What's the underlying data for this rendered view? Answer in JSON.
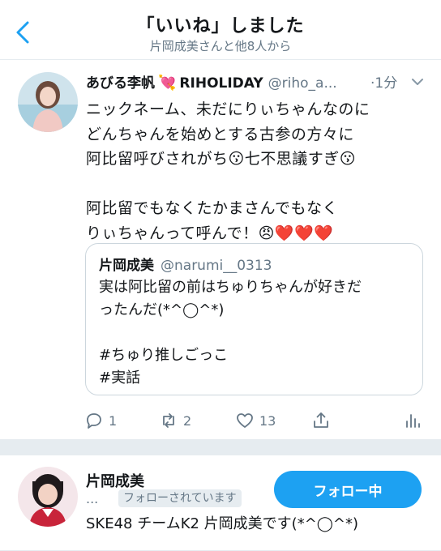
{
  "header": {
    "title": "「いいね」しました",
    "subtitle": "片岡成美さんと他8人から"
  },
  "tweet": {
    "name": "あびる李帆",
    "name_suffix": "RIHOLIDAY",
    "handle": "@riho_a...",
    "time": "·1分",
    "lines": [
      "ニックネーム、未だにりぃちゃんなのに",
      "どんちゃんを始めとする古参の方々に",
      "阿比留呼びされがち😗七不思議すぎ😗",
      "",
      "阿比留でもなくたかまさんでもなく",
      "りぃちゃんって呼んで！😠❤️❤️❤️"
    ],
    "quote": {
      "name": "片岡成美",
      "handle": "@narumi__0313",
      "lines": [
        "実は阿比留の前はちゅりちゃんが好きだ",
        "ったんだ(*^◯^*)",
        "",
        "#ちゅり推しごっこ",
        "#実話"
      ]
    },
    "actions": {
      "reply_count": "1",
      "retweet_count": "2",
      "like_count": "13"
    }
  },
  "user": {
    "name": "片岡成美",
    "ellipsis": "...",
    "follows_you": "フォローされています",
    "follow_button": "フォロー中",
    "bio": "SKE48 チームK2 片岡成美です(*^◯^*)"
  },
  "colors": {
    "accent": "#1da1f2",
    "secondary_text": "#657786",
    "border": "#e6ecf0"
  }
}
